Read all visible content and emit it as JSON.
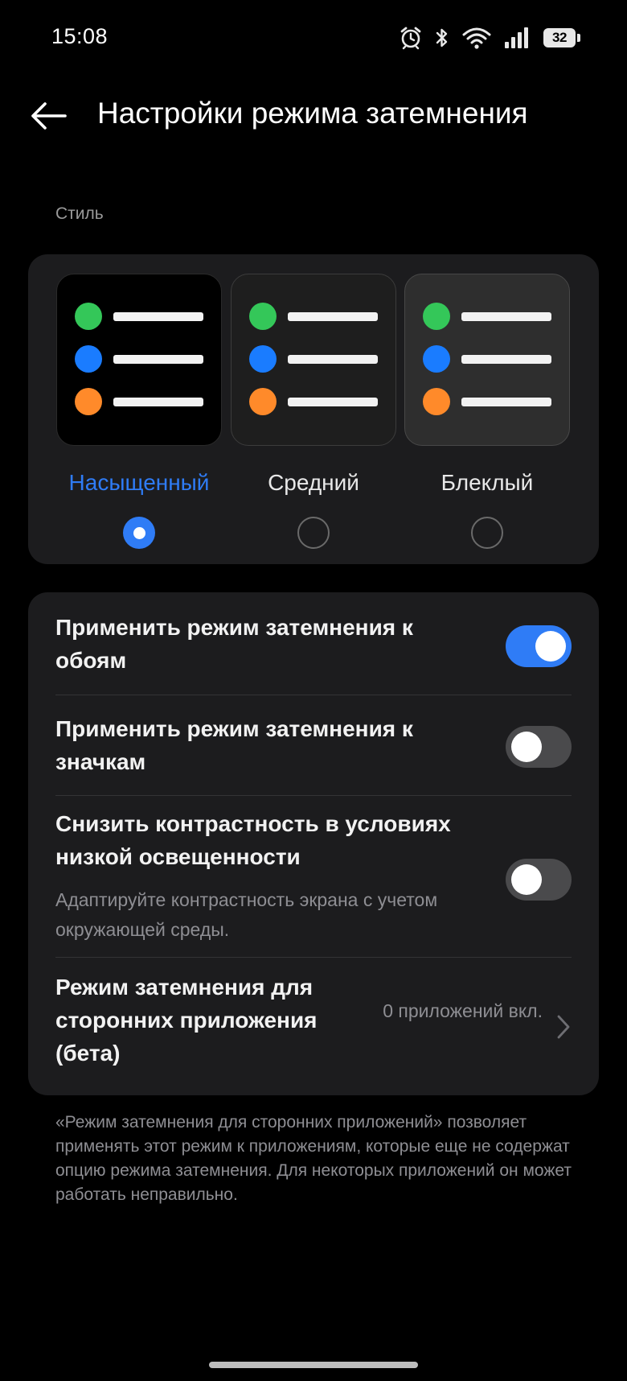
{
  "status_bar": {
    "time": "15:08",
    "battery_level": "32",
    "icons": [
      "alarm-icon",
      "bluetooth-icon",
      "wifi-icon",
      "signal-icon",
      "battery-icon"
    ]
  },
  "header": {
    "title": "Настройки режима затемнения",
    "back_icon": "back-arrow-icon"
  },
  "style_section": {
    "label": "Стиль",
    "options": [
      {
        "label": "Насыщенный",
        "selected": true
      },
      {
        "label": "Средний",
        "selected": false
      },
      {
        "label": "Блеклый",
        "selected": false
      }
    ]
  },
  "settings": {
    "wallpaper": {
      "title": "Применить режим затемнения к обоям",
      "enabled": true
    },
    "icons": {
      "title": "Применить режим затемнения к значкам",
      "enabled": false
    },
    "contrast": {
      "title": "Снизить контрастность в условиях низкой освещенности",
      "subtitle": "Адаптируйте контрастность экрана с учетом окружающей среды.",
      "enabled": false
    },
    "third_party": {
      "title": "Режим затемнения для сторонних приложения (бета)",
      "value": "0 приложений вкл."
    }
  },
  "footer_note": "«Режим затемнения для сторонних приложений» позволяет применять этот режим к приложениям, которые еще не содержат опцию режима затемнения. Для некоторых приложений он может работать неправильно.",
  "colors": {
    "accent": "#2f7cf6",
    "background": "#000000",
    "card": "#1c1c1e",
    "dot_green": "#34c759",
    "dot_blue": "#1a7cff",
    "dot_orange": "#ff8a2a"
  }
}
